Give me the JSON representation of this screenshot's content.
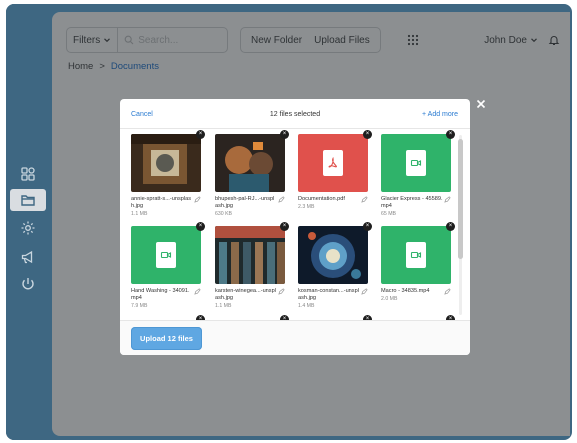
{
  "header": {
    "filters_label": "Filters",
    "search_placeholder": "Search...",
    "new_folder_label": "New Folder",
    "upload_files_label": "Upload Files",
    "user_name": "John Doe"
  },
  "breadcrumb": {
    "home": "Home",
    "separator": ">",
    "current": "Documents"
  },
  "sidebar": {
    "items": [
      {
        "icon": "apps-icon"
      },
      {
        "icon": "folder-icon",
        "active": true
      },
      {
        "icon": "settings-icon"
      },
      {
        "icon": "megaphone-icon"
      },
      {
        "icon": "power-icon"
      }
    ]
  },
  "modal": {
    "cancel_label": "Cancel",
    "selected_text": "12 files selected",
    "add_more_label": "+ Add more",
    "upload_button_label": "Upload 12 files",
    "colors": {
      "pdf": "#e0514c",
      "video": "#2fb36a",
      "link": "#2a7bd1",
      "button": "#5fa7e2"
    },
    "files": [
      {
        "name": "annie-spratt-s...-unsplash.jpg",
        "size": "1.1 MB",
        "kind": "photo"
      },
      {
        "name": "bhupesh-pal-RJ...-unsplash.jpg",
        "size": "630 KB",
        "kind": "photo"
      },
      {
        "name": "Documentation.pdf",
        "size": "2.3 MB",
        "kind": "pdf"
      },
      {
        "name": "Glacier Express - 45589.mp4",
        "size": "65 MB",
        "kind": "video"
      },
      {
        "name": "Hand Washing - 34091.mp4",
        "size": "7.9 MB",
        "kind": "video"
      },
      {
        "name": "karsten-winegea...-unsplash.jpg",
        "size": "1.1 MB",
        "kind": "photo"
      },
      {
        "name": "kosman-constan...-unsplash.jpg",
        "size": "1.4 MB",
        "kind": "photo"
      },
      {
        "name": "Macro - 34835.mp4",
        "size": "2.0 MB",
        "kind": "video"
      }
    ]
  }
}
